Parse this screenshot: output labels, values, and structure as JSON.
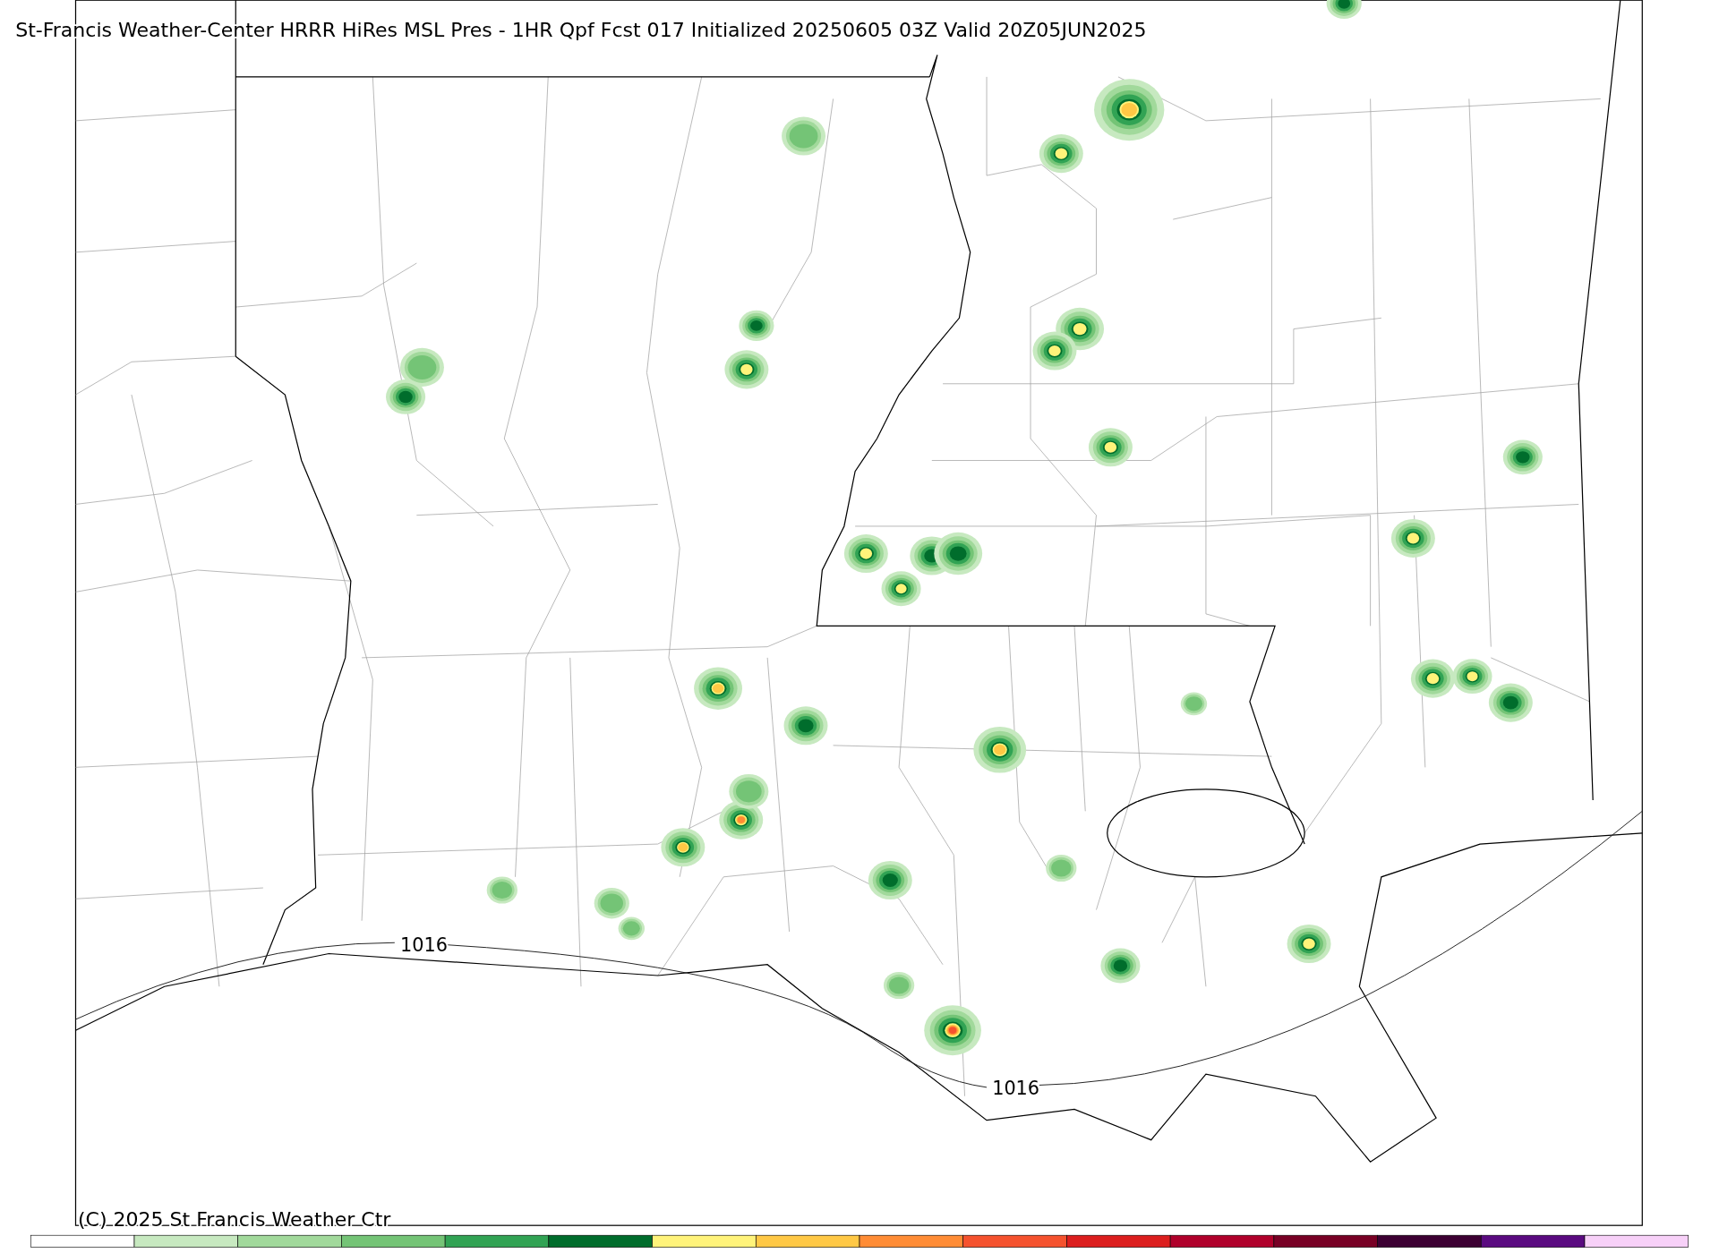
{
  "title": "St-Francis Weather-Center HRRR HiRes MSL Pres - 1HR Qpf Fcst 017 Initialized 20250605 03Z Valid 20Z05JUN2025",
  "copyright": "(C) 2025 St Francis Weather Ctr",
  "isobar_labels": [
    "1016",
    "1016"
  ],
  "colorbar": [
    {
      "color": "#ffffff"
    },
    {
      "color": "#c7e9c0"
    },
    {
      "color": "#a1d99b"
    },
    {
      "color": "#74c476"
    },
    {
      "color": "#31a354"
    },
    {
      "color": "#006d2c"
    },
    {
      "color": "#fff37a"
    },
    {
      "color": "#ffc845"
    },
    {
      "color": "#ff8c35"
    },
    {
      "color": "#f5522e"
    },
    {
      "color": "#dc1e1e"
    },
    {
      "color": "#b0002b"
    },
    {
      "color": "#780025"
    },
    {
      "color": "#3d0033"
    },
    {
      "color": "#5a0a80"
    },
    {
      "color": "#f7d0f8"
    }
  ]
}
